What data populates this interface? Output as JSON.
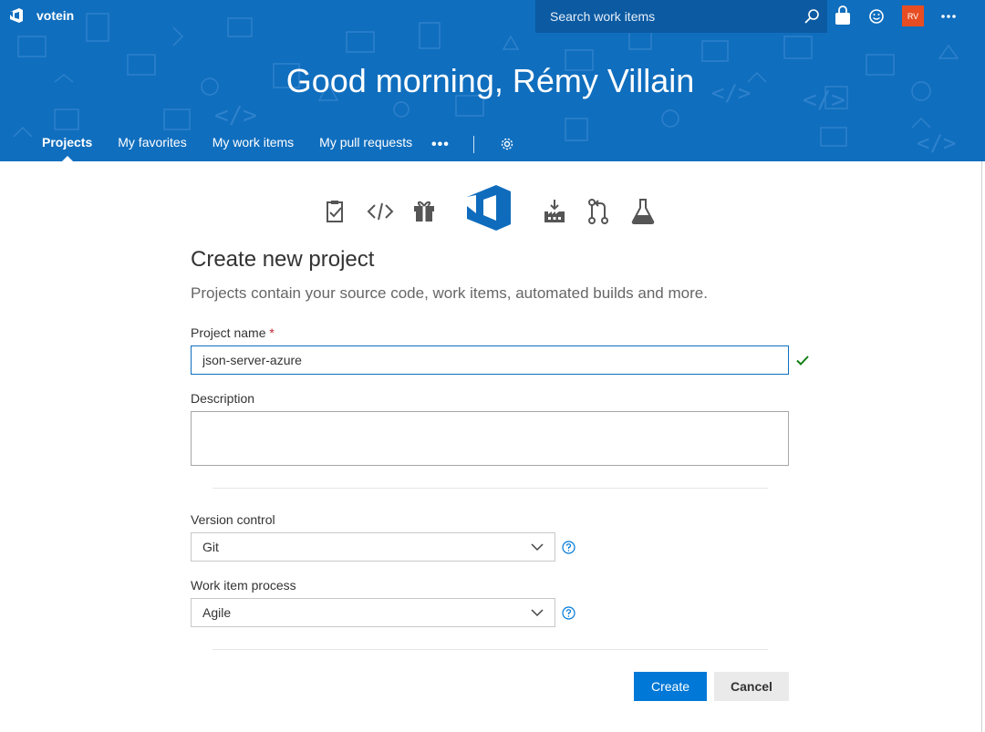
{
  "header": {
    "org_name": "votein",
    "search_placeholder": "Search work items",
    "avatar_initials": "RV",
    "greeting": "Good morning, Rémy Villain",
    "nav": [
      {
        "label": "Projects",
        "active": true
      },
      {
        "label": "My favorites"
      },
      {
        "label": "My work items"
      },
      {
        "label": "My pull requests"
      }
    ],
    "more_label": "•••",
    "icons": {
      "brand": "vsts-logo-icon",
      "search": "search-icon",
      "bag": "shopping-bag-icon",
      "feedback": "smiley-icon",
      "more": "more-icon",
      "settings": "gear-icon"
    }
  },
  "feature_icons": [
    "boards-clipboard-icon",
    "code-icon",
    "gift-icon",
    "vsts-logo-icon",
    "build-factory-icon",
    "pull-request-icon",
    "flask-test-icon"
  ],
  "form": {
    "title": "Create new project",
    "subtitle": "Projects contain your source code, work items, automated builds and more.",
    "project_name_label": "Project name",
    "required_mark": "*",
    "project_name_value": "json-server-azure",
    "description_label": "Description",
    "description_value": "",
    "version_control_label": "Version control",
    "version_control_value": "Git",
    "work_item_process_label": "Work item process",
    "work_item_process_value": "Agile",
    "create_label": "Create",
    "cancel_label": "Cancel"
  },
  "colors": {
    "brand_blue": "#106ebe",
    "primary_button": "#0078d7",
    "avatar_bg": "#e84c22",
    "valid_check": "#107c10"
  }
}
